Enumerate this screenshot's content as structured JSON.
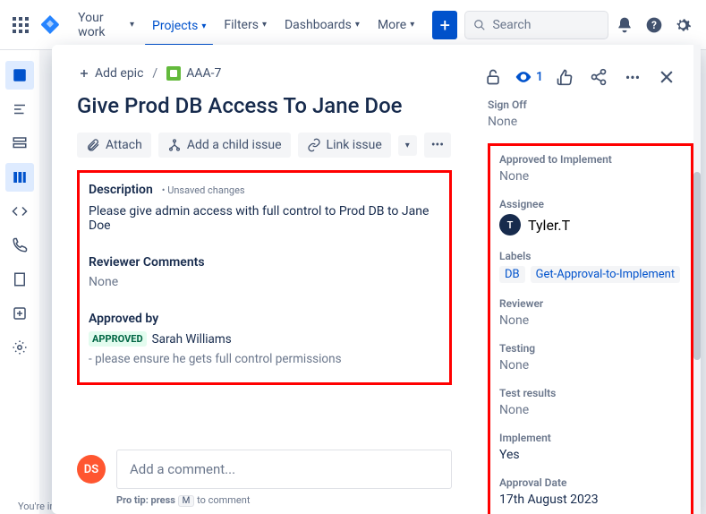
{
  "nav": {
    "yourwork": "Your work",
    "projects": "Projects",
    "filters": "Filters",
    "dashboards": "Dashboards",
    "more": "More",
    "search_placeholder": "Search"
  },
  "breadcrumb": {
    "addepic": "Add epic",
    "issuekey": "AAA-7"
  },
  "title": "Give Prod DB Access To Jane Doe",
  "toolbar": {
    "attach": "Attach",
    "addchild": "Add a child issue",
    "linkissue": "Link issue"
  },
  "desc": {
    "label": "Description",
    "unsaved": "• Unsaved changes",
    "text": "Please give admin access with full control to Prod DB to  Jane Doe"
  },
  "reviewer": {
    "label": "Reviewer Comments",
    "val": "None"
  },
  "approvedby": {
    "label": "Approved by",
    "lozenge": "APPROVED",
    "name": "Sarah Williams",
    "note": "- please ensure he gets full control permissions"
  },
  "comment": {
    "avatar": "DS",
    "placeholder": "Add a comment...",
    "protip_pre": "Pro tip: press",
    "protip_key": "M",
    "protip_post": "to comment"
  },
  "actions": {
    "watch_count": "1"
  },
  "side": {
    "signoff": {
      "label": "Sign Off",
      "val": "None"
    },
    "approvedimpl": {
      "label": "Approved to Implement",
      "val": "None"
    },
    "assignee": {
      "label": "Assignee",
      "initial": "T",
      "name": "Tyler.T"
    },
    "labels": {
      "label": "Labels",
      "items": [
        "DB",
        "Get-Approval-to-Implement"
      ]
    },
    "reviewer": {
      "label": "Reviewer",
      "val": "None"
    },
    "testing": {
      "label": "Testing",
      "val": "None"
    },
    "testresults": {
      "label": "Test results",
      "val": "None"
    },
    "implement": {
      "label": "Implement",
      "val": "Yes"
    },
    "approvaldate": {
      "label": "Approval Date",
      "val": "17th August 2023"
    }
  },
  "footer": "You're in a team-managed project"
}
